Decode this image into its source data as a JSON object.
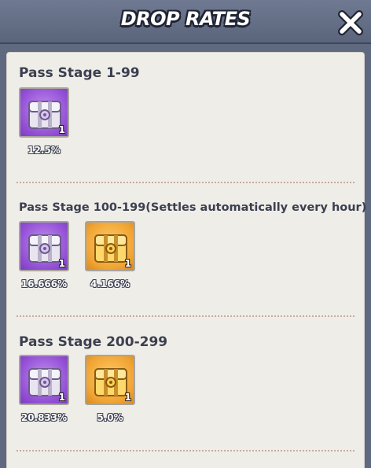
{
  "header": {
    "title": "DROP RATES",
    "close_icon": "close-icon"
  },
  "sections": [
    {
      "title": "Pass Stage 1-99",
      "items": [
        {
          "type": "purple-chest",
          "icon": "purple-chest-icon",
          "quantity": "1",
          "rate": "12.5%"
        }
      ]
    },
    {
      "title": "Pass Stage 100-199(Settles automatically every hour)",
      "items": [
        {
          "type": "purple-chest",
          "icon": "purple-chest-icon",
          "quantity": "1",
          "rate": "16.666%"
        },
        {
          "type": "gold-chest",
          "icon": "gold-chest-icon",
          "quantity": "1",
          "rate": "4.166%"
        }
      ]
    },
    {
      "title": "Pass Stage 200-299",
      "items": [
        {
          "type": "purple-chest",
          "icon": "purple-chest-icon",
          "quantity": "1",
          "rate": "20.833%"
        },
        {
          "type": "gold-chest",
          "icon": "gold-chest-icon",
          "quantity": "1",
          "rate": "5.0%"
        }
      ]
    }
  ],
  "colors": {
    "purple_card": "#9350d6",
    "gold_card": "#f0a433",
    "panel": "#efede8",
    "header": "#5f6a80"
  }
}
